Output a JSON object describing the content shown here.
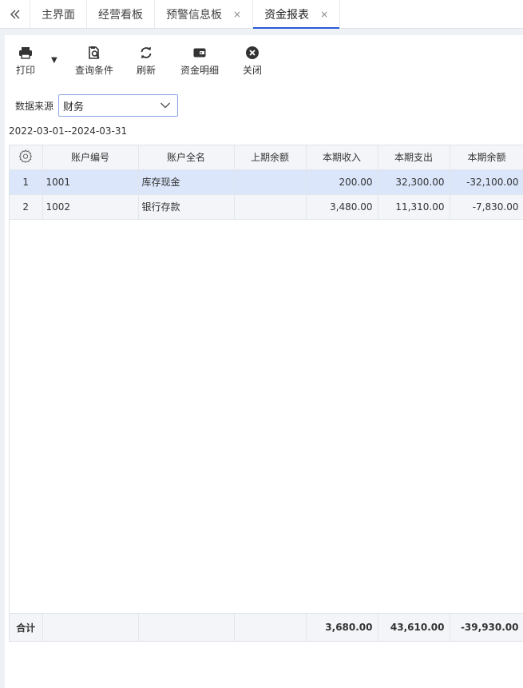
{
  "tabs": [
    {
      "label": "主界面",
      "closable": false,
      "active": false
    },
    {
      "label": "经营看板",
      "closable": false,
      "active": false
    },
    {
      "label": "预警信息板",
      "closable": true,
      "active": false
    },
    {
      "label": "资金报表",
      "closable": true,
      "active": true
    }
  ],
  "tab_close_glyph": "×",
  "toolbar": {
    "print": "打印",
    "query": "查询条件",
    "refresh": "刷新",
    "detail": "资金明细",
    "close": "关闭"
  },
  "filter": {
    "label": "数据来源",
    "value": "财务"
  },
  "date_range": "2022-03-01--2024-03-31",
  "table": {
    "columns": [
      "账户编号",
      "账户全名",
      "上期余额",
      "本期收入",
      "本期支出",
      "本期余额"
    ],
    "rows": [
      {
        "idx": "1",
        "code": "1001",
        "name": "库存现金",
        "prev": "",
        "income": "200.00",
        "expense": "32,300.00",
        "balance": "-32,100.00",
        "selected": true
      },
      {
        "idx": "2",
        "code": "1002",
        "name": "银行存款",
        "prev": "",
        "income": "3,480.00",
        "expense": "11,310.00",
        "balance": "-7,830.00",
        "selected": false
      }
    ],
    "totals": {
      "label": "合计",
      "income": "3,680.00",
      "expense": "43,610.00",
      "balance": "-39,930.00"
    }
  },
  "colors": {
    "accent": "#2a5ad8",
    "selected_row": "#dbe6fb"
  }
}
